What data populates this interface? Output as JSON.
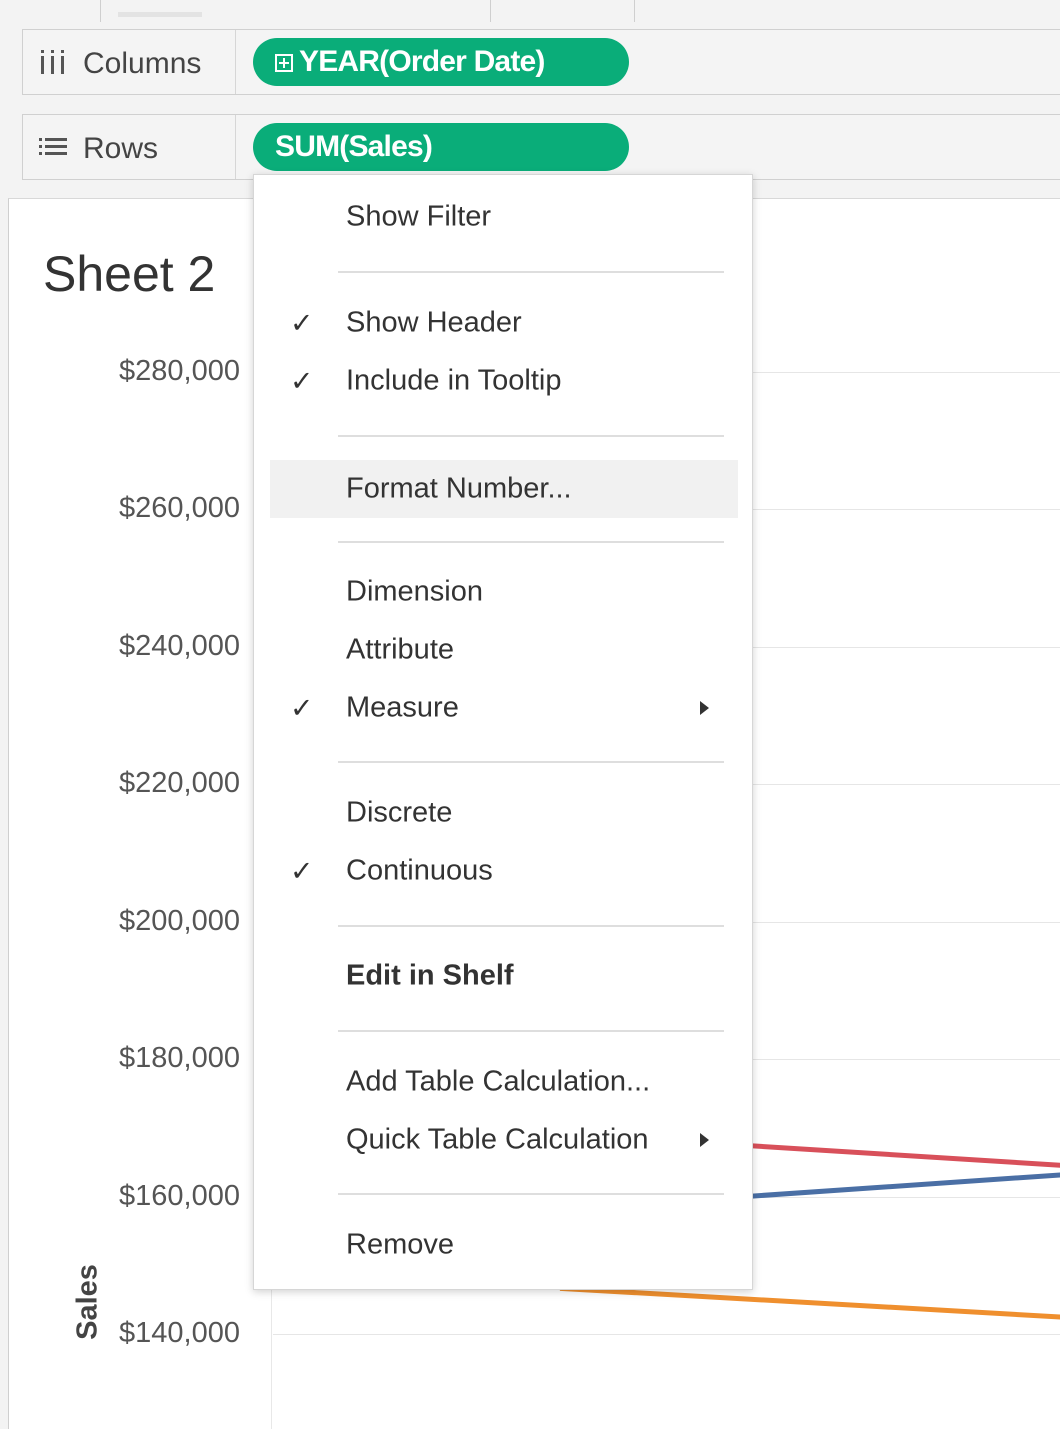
{
  "shelves": {
    "columns": {
      "label": "Columns",
      "pill": "YEAR(Order Date)"
    },
    "rows": {
      "label": "Rows",
      "pill": "SUM(Sales)"
    }
  },
  "sheet": {
    "title": "Sheet 2"
  },
  "chart_data": {
    "type": "line",
    "ylabel": "Sales",
    "yticks": [
      "$280,000",
      "$260,000",
      "$240,000",
      "$220,000",
      "$200,000",
      "$180,000",
      "$160,000",
      "$140,000"
    ],
    "ylim": [
      140000,
      280000
    ],
    "series": [
      {
        "color": "#d8505a",
        "values": [
          169000,
          163500
        ]
      },
      {
        "color": "#4a6fa5",
        "values": [
          158000,
          164000
        ]
      },
      {
        "color": "#ef8f2e",
        "values": [
          146500,
          141500
        ]
      }
    ]
  },
  "menu": {
    "show_filter": "Show Filter",
    "show_header": "Show Header",
    "include_tooltip": "Include in Tooltip",
    "format_number": "Format Number...",
    "dimension": "Dimension",
    "attribute": "Attribute",
    "measure": "Measure",
    "discrete": "Discrete",
    "continuous": "Continuous",
    "edit_shelf": "Edit in Shelf",
    "add_table_calc": "Add Table Calculation...",
    "quick_table_calc": "Quick Table Calculation",
    "remove": "Remove",
    "check_glyph": "✓"
  }
}
